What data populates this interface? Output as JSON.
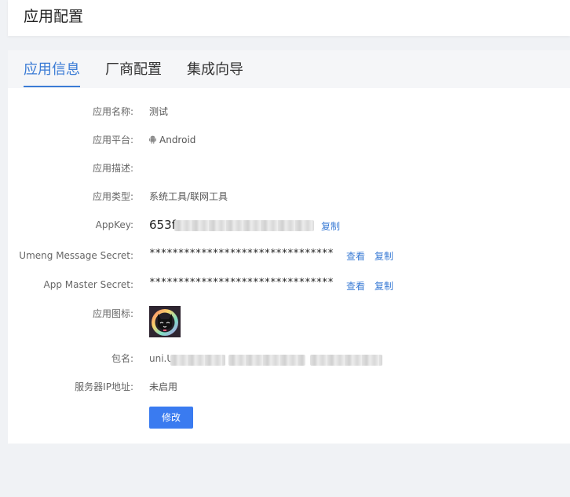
{
  "page": {
    "title": "应用配置"
  },
  "tabs": [
    {
      "label": "应用信息",
      "active": true
    },
    {
      "label": "厂商配置",
      "active": false
    },
    {
      "label": "集成向导",
      "active": false
    }
  ],
  "fields": {
    "name": {
      "label": "应用名称:",
      "value": "测试"
    },
    "platform": {
      "label": "应用平台:",
      "value": "Android",
      "icon": "android-icon"
    },
    "description": {
      "label": "应用描述:",
      "value": ""
    },
    "type": {
      "label": "应用类型:",
      "value": "系统工具/联网工具"
    },
    "appkey": {
      "label": "AppKey:",
      "value_prefix": "653f",
      "copy_label": "复制"
    },
    "umeng_secret": {
      "label": "Umeng Message Secret:",
      "value": "********************************",
      "view_label": "查看",
      "copy_label": "复制"
    },
    "master_secret": {
      "label": "App Master Secret:",
      "value": "********************************",
      "view_label": "查看",
      "copy_label": "复制"
    },
    "icon": {
      "label": "应用图标:"
    },
    "package": {
      "label": "包名:",
      "value_prefix": "uni.U"
    },
    "server_ip": {
      "label": "服务器IP地址:",
      "value": "未启用"
    }
  },
  "actions": {
    "edit_label": "修改"
  },
  "colors": {
    "accent": "#3a7bd5",
    "button": "#3a7bf0",
    "tab_bg": "#f5f6f8",
    "page_bg": "#f0f2f5"
  }
}
